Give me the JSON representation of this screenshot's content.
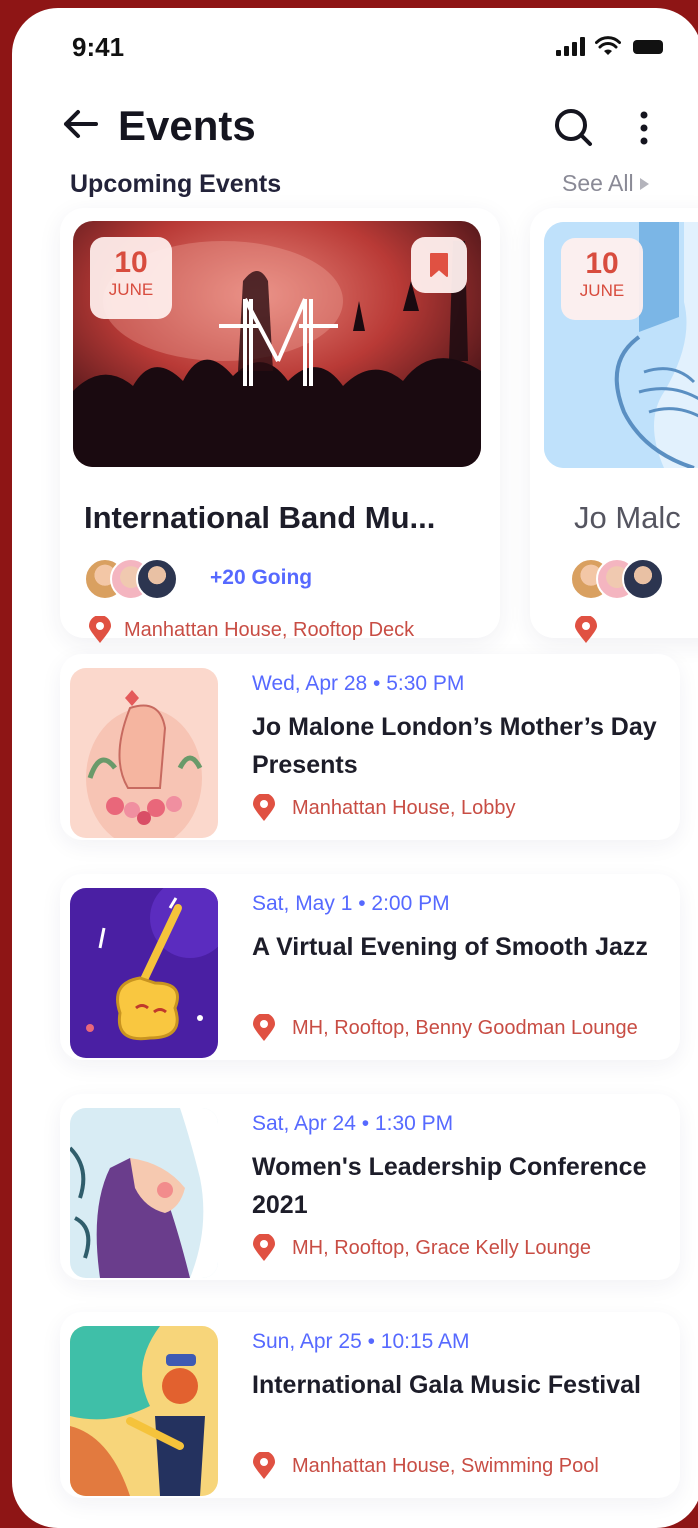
{
  "status": {
    "time": "9:41"
  },
  "header": {
    "title": "Events"
  },
  "upcoming": {
    "section_title": "Upcoming Events",
    "see_all": "See All",
    "cards": [
      {
        "day": "10",
        "month": "JUNE",
        "name": "International Band Mu...",
        "going": "+20 Going",
        "location": "Manhattan House, Rooftop Deck"
      },
      {
        "day": "10",
        "month": "JUNE",
        "name": "Jo Malc"
      }
    ]
  },
  "events": [
    {
      "date": "Wed, Apr 28 • 5:30 PM",
      "title": "Jo Malone London’s Mother’s Day Presents",
      "location": "Manhattan House, Lobby"
    },
    {
      "date": "Sat, May 1 • 2:00 PM",
      "title": "A Virtual Evening of Smooth Jazz",
      "location": "MH, Rooftop, Benny Goodman Lounge"
    },
    {
      "date": "Sat, Apr 24 • 1:30 PM",
      "title": "Women's Leadership Conference 2021",
      "location": "MH, Rooftop, Grace Kelly Lounge"
    },
    {
      "date": "Sun, Apr 25 • 10:15 AM",
      "title": "International Gala Music Festival",
      "location": "Manhattan House, Swimming Pool"
    }
  ],
  "colors": {
    "accent": "#5669ff",
    "location": "#c84d44",
    "frame": "#8e1515"
  }
}
